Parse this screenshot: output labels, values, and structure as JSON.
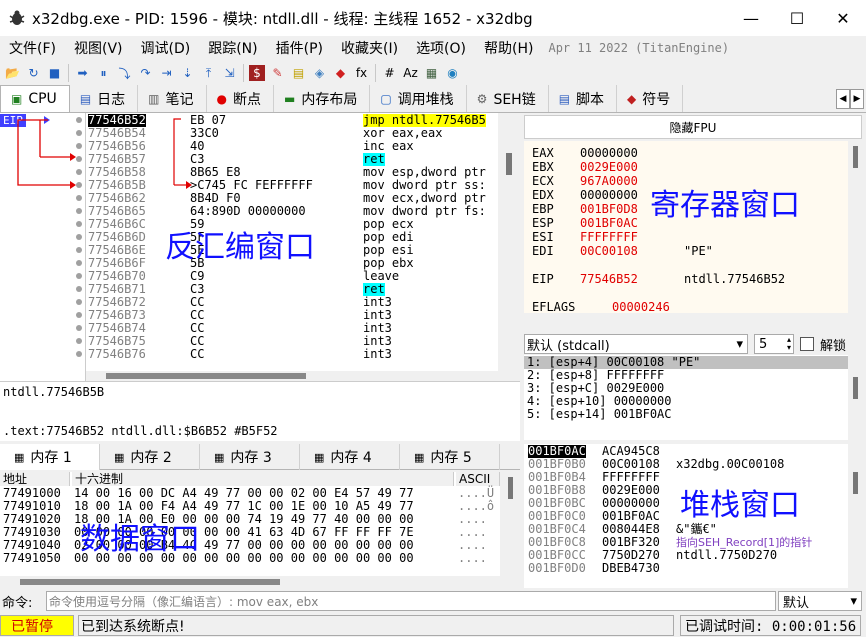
{
  "window": {
    "title": "x32dbg.exe - PID: 1596 - 模块: ntdll.dll - 线程: 主线程 1652 - x32dbg",
    "minimize": "—",
    "maximize": "☐",
    "close": "✕"
  },
  "menu": {
    "items": [
      "文件(F)",
      "视图(V)",
      "调试(D)",
      "跟踪(N)",
      "插件(P)",
      "收藏夹(I)",
      "选项(O)",
      "帮助(H)"
    ],
    "date": "Apr 11 2022 (TitanEngine)"
  },
  "toolbar": {
    "icons": [
      "open-icon",
      "restart-icon",
      "stop-icon",
      "run-icon",
      "pause-icon",
      "step-into-icon",
      "step-over-icon",
      "animate-into-icon",
      "animate-over-icon",
      "run-to-user-icon",
      "execute-till-return-icon",
      "script-icon",
      "patch-icon",
      "comment-icon",
      "label-icon",
      "bookmark-icon",
      "function-icon",
      "hash-icon",
      "strings-icon",
      "calculator-icon",
      "globe-icon"
    ],
    "glyphs": [
      "📂",
      "↻",
      "■",
      "➡",
      "⏸",
      "⤵",
      "↷",
      "⇥",
      "⇣",
      "⤒",
      "⇲",
      "$",
      "✎",
      "▤",
      "◈",
      "◆",
      "fx",
      "#",
      "Az",
      "▦",
      "◉"
    ]
  },
  "tabs": [
    {
      "icon": "▣",
      "label": "CPU"
    },
    {
      "icon": "▤",
      "label": "日志"
    },
    {
      "icon": "▥",
      "label": "笔记"
    },
    {
      "icon": "●",
      "label": "断点"
    },
    {
      "icon": "▬",
      "label": "内存布局"
    },
    {
      "icon": "▢",
      "label": "调用堆栈"
    },
    {
      "icon": "⚙",
      "label": "SEH链"
    },
    {
      "icon": "▤",
      "label": "脚本"
    },
    {
      "icon": "◆",
      "label": "符号"
    }
  ],
  "tab_arrows": {
    "left": "◀",
    "right": "▶"
  },
  "disasm": {
    "eip_label": "EIP",
    "overlay_label": "反汇编窗口",
    "rows": [
      {
        "addr": "77546B52",
        "bytes": "EB 07",
        "ins": "jmp ntdll.77546B5",
        "sel": true,
        "hl": "yellow"
      },
      {
        "addr": "77546B54",
        "bytes": "33C0",
        "ins": "xor eax,eax"
      },
      {
        "addr": "77546B56",
        "bytes": "40",
        "ins": "inc eax"
      },
      {
        "addr": "77546B57",
        "bytes": "C3",
        "ins": "ret",
        "hl": "cyan"
      },
      {
        "addr": "77546B58",
        "bytes": "8B65 E8",
        "ins": "mov esp,dword ptr"
      },
      {
        "addr": "77546B5B",
        "bytes": ">C745 FC FEFFFFFF",
        "ins": "mov dword ptr ss:"
      },
      {
        "addr": "77546B62",
        "bytes": "8B4D F0",
        "ins": "mov ecx,dword ptr"
      },
      {
        "addr": "77546B65",
        "bytes": "64:890D 00000000",
        "ins": "mov dword ptr fs:"
      },
      {
        "addr": "77546B6C",
        "bytes": "59",
        "ins": "pop ecx"
      },
      {
        "addr": "77546B6D",
        "bytes": "5F",
        "ins": "pop edi"
      },
      {
        "addr": "77546B6E",
        "bytes": "5E",
        "ins": "pop esi"
      },
      {
        "addr": "77546B6F",
        "bytes": "5B",
        "ins": "pop ebx"
      },
      {
        "addr": "77546B70",
        "bytes": "C9",
        "ins": "leave"
      },
      {
        "addr": "77546B71",
        "bytes": "C3",
        "ins": "ret",
        "hl": "cyan"
      },
      {
        "addr": "77546B72",
        "bytes": "CC",
        "ins": "int3"
      },
      {
        "addr": "77546B73",
        "bytes": "CC",
        "ins": "int3"
      },
      {
        "addr": "77546B74",
        "bytes": "CC",
        "ins": "int3"
      },
      {
        "addr": "77546B75",
        "bytes": "CC",
        "ins": "int3"
      },
      {
        "addr": "77546B76",
        "bytes": "CC",
        "ins": "int3"
      }
    ]
  },
  "info": {
    "line1": "ntdll.77546B5B",
    "line2": ".text:77546B52 ntdll.dll:$B6B52 #B5F52"
  },
  "registers": {
    "hide_fpu": "隐藏FPU",
    "overlay_label": "寄存器窗口",
    "rows": [
      {
        "name": "EAX",
        "value": "00000000",
        "comment": "",
        "red": false
      },
      {
        "name": "EBX",
        "value": "0029E000",
        "comment": "",
        "red": true
      },
      {
        "name": "ECX",
        "value": "967A0000",
        "comment": "",
        "red": true
      },
      {
        "name": "EDX",
        "value": "00000000",
        "comment": "",
        "red": false
      },
      {
        "name": "EBP",
        "value": "001BF0D8",
        "comment": "",
        "red": true
      },
      {
        "name": "ESP",
        "value": "001BF0AC",
        "comment": "",
        "red": true
      },
      {
        "name": "ESI",
        "value": "FFFFFFFF",
        "comment": "",
        "red": true
      },
      {
        "name": "EDI",
        "value": "00C00108",
        "comment": "\"PE\"",
        "red": true
      },
      {
        "name": "EIP",
        "value": "77546B52",
        "comment": "ntdll.77546B52",
        "red": true
      },
      {
        "name": "EFLAGS",
        "value": "00000246",
        "comment": "",
        "red": true
      }
    ]
  },
  "callconv": {
    "selected": "默认 (stdcall)",
    "count": "5",
    "lock_label": "解锁"
  },
  "args": [
    {
      "text": "1: [esp+4] 00C00108 \"PE\"",
      "sel": true
    },
    {
      "text": "2: [esp+8] FFFFFFFF",
      "sel": false
    },
    {
      "text": "3: [esp+C] 0029E000",
      "sel": false
    },
    {
      "text": "4: [esp+10] 00000000",
      "sel": false
    },
    {
      "text": "5: [esp+14] 001BF0AC",
      "sel": false
    }
  ],
  "memtabs": [
    "内存 1",
    "内存 2",
    "内存 3",
    "内存 4",
    "内存 5"
  ],
  "dump": {
    "header_addr": "地址",
    "header_hex": "十六进制",
    "header_ascii": "ASCII",
    "overlay_label": "数据窗口",
    "rows": [
      {
        "addr": "77491000",
        "hex": "14 00 16 00 DC A4 49 77 00 00 02 00 E4 57 49 77",
        "ascii": "....Ü"
      },
      {
        "addr": "77491010",
        "hex": "18 00 1A 00 F4 A4 49 77 1C 00 1E 00 10 A5 49 77",
        "ascii": "....ô"
      },
      {
        "addr": "77491020",
        "hex": "18 00 1A 00 E0 00 00 00 74 19 49 77 40 00 00 00",
        "ascii": "...."
      },
      {
        "addr": "77491030",
        "hex": "00 00 00 00 00 00 00 00 41 63 4D 67 FF FF FF 7E",
        "ascii": "...."
      },
      {
        "addr": "77491040",
        "hex": "02 00 00 00 B4 4C 49 77 00 00 00 00 00 00 00 00",
        "ascii": "...."
      },
      {
        "addr": "77491050",
        "hex": "00 00 00 00 00 00 00 00 00 00 00 00 00 00 00 00",
        "ascii": "...."
      }
    ]
  },
  "stack": {
    "overlay_label": "堆栈窗口",
    "rows": [
      {
        "addr": "001BF0AC",
        "value": "ACA945C8",
        "comment": "",
        "top": true
      },
      {
        "addr": "001BF0B0",
        "value": "00C00108",
        "comment": "x32dbg.00C00108"
      },
      {
        "addr": "001BF0B4",
        "value": "FFFFFFFF",
        "comment": ""
      },
      {
        "addr": "001BF0B8",
        "value": "0029E000",
        "comment": ""
      },
      {
        "addr": "001BF0BC",
        "value": "00000000",
        "comment": ""
      },
      {
        "addr": "001BF0C0",
        "value": "001BF0AC",
        "comment": ""
      },
      {
        "addr": "001BF0C4",
        "value": "008044E8",
        "comment": "&\"鑴€\""
      },
      {
        "addr": "001BF0C8",
        "value": "001BF320",
        "comment": "指向SEH_Record[1]的指针",
        "purple": true
      },
      {
        "addr": "001BF0CC",
        "value": "7750D270",
        "comment": "ntdll.7750D270"
      },
      {
        "addr": "001BF0D0",
        "value": "DBEB4730",
        "comment": ""
      }
    ]
  },
  "command": {
    "label": "命令:",
    "placeholder": "命令使用逗号分隔（像汇编语言）: mov eax, ebx",
    "mode": "默认"
  },
  "status": {
    "paused": "已暂停",
    "message": "已到达系统断点!",
    "time": "已调试时间:  0:00:01:56"
  },
  "colors": {
    "accent_blue": "#1010ff",
    "reg_changed": "#e00000",
    "jmp_highlight": "#ffff00",
    "ret_highlight": "#00ffff",
    "paused_bg": "#ffff00"
  }
}
